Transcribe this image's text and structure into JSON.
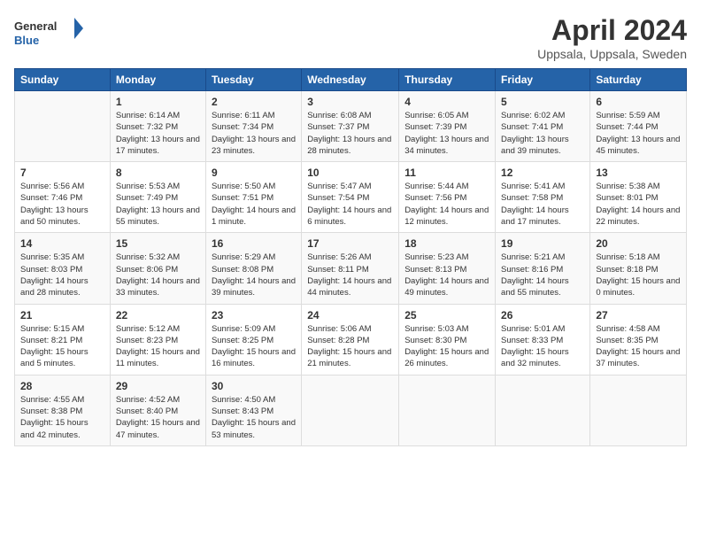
{
  "header": {
    "logo_line1": "General",
    "logo_line2": "Blue",
    "month": "April 2024",
    "location": "Uppsala, Uppsala, Sweden"
  },
  "columns": [
    "Sunday",
    "Monday",
    "Tuesday",
    "Wednesday",
    "Thursday",
    "Friday",
    "Saturday"
  ],
  "weeks": [
    [
      {
        "day": "",
        "sunrise": "",
        "sunset": "",
        "daylight": ""
      },
      {
        "day": "1",
        "sunrise": "Sunrise: 6:14 AM",
        "sunset": "Sunset: 7:32 PM",
        "daylight": "Daylight: 13 hours and 17 minutes."
      },
      {
        "day": "2",
        "sunrise": "Sunrise: 6:11 AM",
        "sunset": "Sunset: 7:34 PM",
        "daylight": "Daylight: 13 hours and 23 minutes."
      },
      {
        "day": "3",
        "sunrise": "Sunrise: 6:08 AM",
        "sunset": "Sunset: 7:37 PM",
        "daylight": "Daylight: 13 hours and 28 minutes."
      },
      {
        "day": "4",
        "sunrise": "Sunrise: 6:05 AM",
        "sunset": "Sunset: 7:39 PM",
        "daylight": "Daylight: 13 hours and 34 minutes."
      },
      {
        "day": "5",
        "sunrise": "Sunrise: 6:02 AM",
        "sunset": "Sunset: 7:41 PM",
        "daylight": "Daylight: 13 hours and 39 minutes."
      },
      {
        "day": "6",
        "sunrise": "Sunrise: 5:59 AM",
        "sunset": "Sunset: 7:44 PM",
        "daylight": "Daylight: 13 hours and 45 minutes."
      }
    ],
    [
      {
        "day": "7",
        "sunrise": "Sunrise: 5:56 AM",
        "sunset": "Sunset: 7:46 PM",
        "daylight": "Daylight: 13 hours and 50 minutes."
      },
      {
        "day": "8",
        "sunrise": "Sunrise: 5:53 AM",
        "sunset": "Sunset: 7:49 PM",
        "daylight": "Daylight: 13 hours and 55 minutes."
      },
      {
        "day": "9",
        "sunrise": "Sunrise: 5:50 AM",
        "sunset": "Sunset: 7:51 PM",
        "daylight": "Daylight: 14 hours and 1 minute."
      },
      {
        "day": "10",
        "sunrise": "Sunrise: 5:47 AM",
        "sunset": "Sunset: 7:54 PM",
        "daylight": "Daylight: 14 hours and 6 minutes."
      },
      {
        "day": "11",
        "sunrise": "Sunrise: 5:44 AM",
        "sunset": "Sunset: 7:56 PM",
        "daylight": "Daylight: 14 hours and 12 minutes."
      },
      {
        "day": "12",
        "sunrise": "Sunrise: 5:41 AM",
        "sunset": "Sunset: 7:58 PM",
        "daylight": "Daylight: 14 hours and 17 minutes."
      },
      {
        "day": "13",
        "sunrise": "Sunrise: 5:38 AM",
        "sunset": "Sunset: 8:01 PM",
        "daylight": "Daylight: 14 hours and 22 minutes."
      }
    ],
    [
      {
        "day": "14",
        "sunrise": "Sunrise: 5:35 AM",
        "sunset": "Sunset: 8:03 PM",
        "daylight": "Daylight: 14 hours and 28 minutes."
      },
      {
        "day": "15",
        "sunrise": "Sunrise: 5:32 AM",
        "sunset": "Sunset: 8:06 PM",
        "daylight": "Daylight: 14 hours and 33 minutes."
      },
      {
        "day": "16",
        "sunrise": "Sunrise: 5:29 AM",
        "sunset": "Sunset: 8:08 PM",
        "daylight": "Daylight: 14 hours and 39 minutes."
      },
      {
        "day": "17",
        "sunrise": "Sunrise: 5:26 AM",
        "sunset": "Sunset: 8:11 PM",
        "daylight": "Daylight: 14 hours and 44 minutes."
      },
      {
        "day": "18",
        "sunrise": "Sunrise: 5:23 AM",
        "sunset": "Sunset: 8:13 PM",
        "daylight": "Daylight: 14 hours and 49 minutes."
      },
      {
        "day": "19",
        "sunrise": "Sunrise: 5:21 AM",
        "sunset": "Sunset: 8:16 PM",
        "daylight": "Daylight: 14 hours and 55 minutes."
      },
      {
        "day": "20",
        "sunrise": "Sunrise: 5:18 AM",
        "sunset": "Sunset: 8:18 PM",
        "daylight": "Daylight: 15 hours and 0 minutes."
      }
    ],
    [
      {
        "day": "21",
        "sunrise": "Sunrise: 5:15 AM",
        "sunset": "Sunset: 8:21 PM",
        "daylight": "Daylight: 15 hours and 5 minutes."
      },
      {
        "day": "22",
        "sunrise": "Sunrise: 5:12 AM",
        "sunset": "Sunset: 8:23 PM",
        "daylight": "Daylight: 15 hours and 11 minutes."
      },
      {
        "day": "23",
        "sunrise": "Sunrise: 5:09 AM",
        "sunset": "Sunset: 8:25 PM",
        "daylight": "Daylight: 15 hours and 16 minutes."
      },
      {
        "day": "24",
        "sunrise": "Sunrise: 5:06 AM",
        "sunset": "Sunset: 8:28 PM",
        "daylight": "Daylight: 15 hours and 21 minutes."
      },
      {
        "day": "25",
        "sunrise": "Sunrise: 5:03 AM",
        "sunset": "Sunset: 8:30 PM",
        "daylight": "Daylight: 15 hours and 26 minutes."
      },
      {
        "day": "26",
        "sunrise": "Sunrise: 5:01 AM",
        "sunset": "Sunset: 8:33 PM",
        "daylight": "Daylight: 15 hours and 32 minutes."
      },
      {
        "day": "27",
        "sunrise": "Sunrise: 4:58 AM",
        "sunset": "Sunset: 8:35 PM",
        "daylight": "Daylight: 15 hours and 37 minutes."
      }
    ],
    [
      {
        "day": "28",
        "sunrise": "Sunrise: 4:55 AM",
        "sunset": "Sunset: 8:38 PM",
        "daylight": "Daylight: 15 hours and 42 minutes."
      },
      {
        "day": "29",
        "sunrise": "Sunrise: 4:52 AM",
        "sunset": "Sunset: 8:40 PM",
        "daylight": "Daylight: 15 hours and 47 minutes."
      },
      {
        "day": "30",
        "sunrise": "Sunrise: 4:50 AM",
        "sunset": "Sunset: 8:43 PM",
        "daylight": "Daylight: 15 hours and 53 minutes."
      },
      {
        "day": "",
        "sunrise": "",
        "sunset": "",
        "daylight": ""
      },
      {
        "day": "",
        "sunrise": "",
        "sunset": "",
        "daylight": ""
      },
      {
        "day": "",
        "sunrise": "",
        "sunset": "",
        "daylight": ""
      },
      {
        "day": "",
        "sunrise": "",
        "sunset": "",
        "daylight": ""
      }
    ]
  ]
}
